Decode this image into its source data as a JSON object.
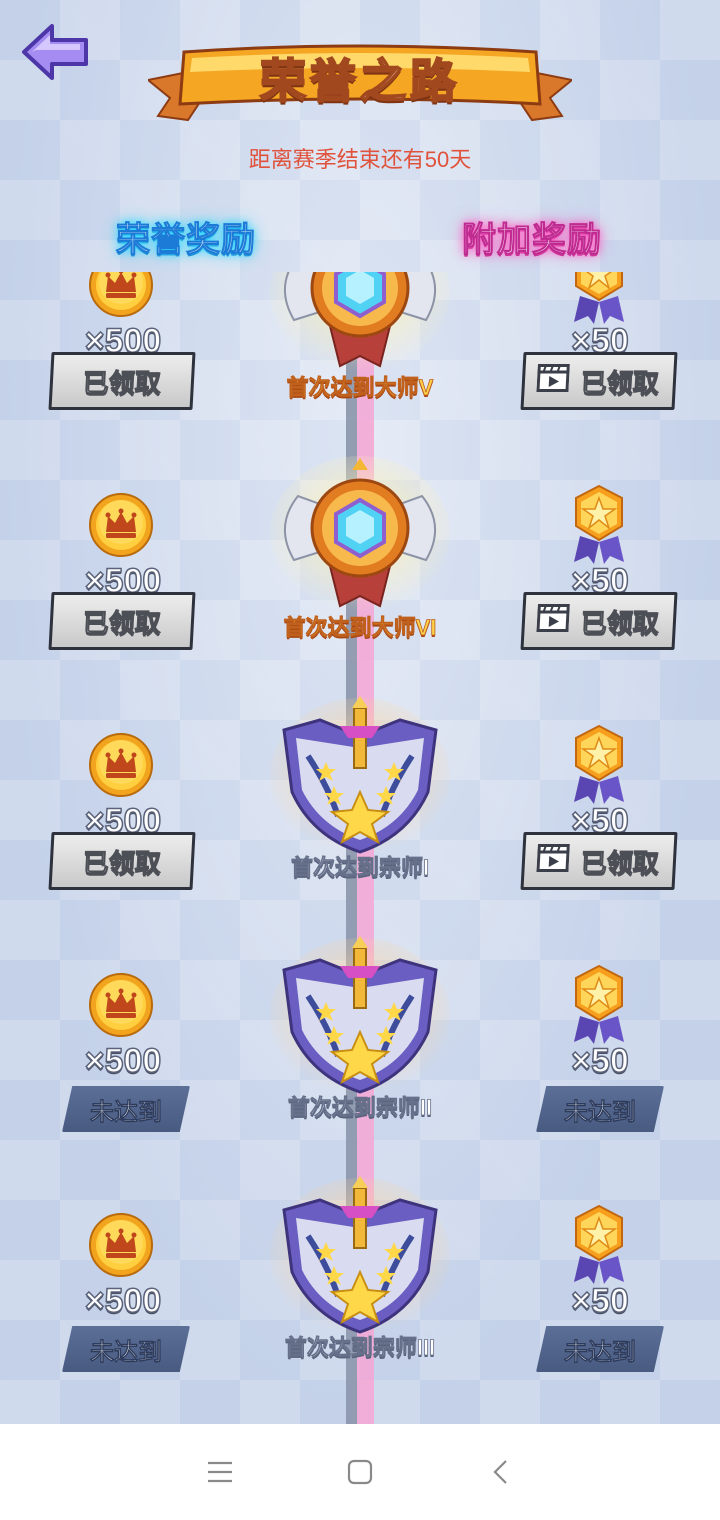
{
  "header": {
    "title": "荣誉之路",
    "season_remaining": "距离赛季结束还有50天",
    "left_column_title": "荣誉奖励",
    "right_column_title": "附加奖励"
  },
  "rewards": [
    {
      "left_amount": "×500",
      "right_amount": "×50",
      "badge_label": "首次达到大师V",
      "badge_tier": "gold",
      "left_status": "已领取",
      "right_status": "已领取",
      "claimed": true
    },
    {
      "left_amount": "×500",
      "right_amount": "×50",
      "badge_label": "首次达到大师VI",
      "badge_tier": "gold",
      "left_status": "已领取",
      "right_status": "已领取",
      "claimed": true
    },
    {
      "left_amount": "×500",
      "right_amount": "×50",
      "badge_label": "首次达到宗师I",
      "badge_tier": "silver",
      "left_status": "已领取",
      "right_status": "已领取",
      "claimed": true
    },
    {
      "left_amount": "×500",
      "right_amount": "×50",
      "badge_label": "首次达到宗师II",
      "badge_tier": "silver",
      "left_status": "未达到",
      "right_status": "未达到",
      "claimed": false
    },
    {
      "left_amount": "×500",
      "right_amount": "×50",
      "badge_label": "首次达到宗师III",
      "badge_tier": "silver",
      "left_status": "未达到",
      "right_status": "未达到",
      "claimed": false
    }
  ],
  "icons": {
    "back": "back-arrow-icon",
    "left_reward": "crown-coin-icon",
    "right_reward": "star-medal-icon",
    "video": "video-ad-icon",
    "nav": [
      "menu-icon",
      "home-icon",
      "back-icon"
    ]
  },
  "colors": {
    "season_text": "#e0523b",
    "left_header_glow": "#2fd7ff",
    "right_header_glow": "#ff5fc4",
    "gold_label": "#ffd24a"
  }
}
